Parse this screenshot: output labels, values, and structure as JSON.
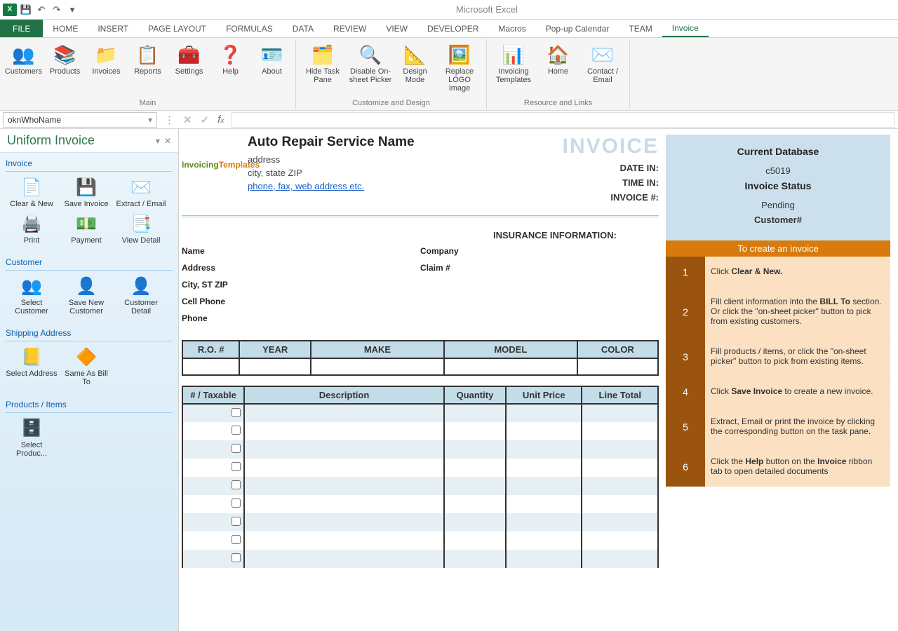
{
  "app_title": "Microsoft Excel",
  "ribbon_tabs": [
    "FILE",
    "HOME",
    "INSERT",
    "PAGE LAYOUT",
    "FORMULAS",
    "DATA",
    "REVIEW",
    "VIEW",
    "DEVELOPER",
    "Macros",
    "Pop-up Calendar",
    "TEAM",
    "Invoice"
  ],
  "ribbon_groups": {
    "main_label": "Main",
    "customize_label": "Customize and Design",
    "resource_label": "Resource and Links",
    "main": [
      "Customers",
      "Products",
      "Invoices",
      "Reports",
      "Settings",
      "Help",
      "About"
    ],
    "customize": [
      "Hide Task Pane",
      "Disable On-sheet Picker",
      "Design Mode",
      "Replace LOGO Image"
    ],
    "resource": [
      "Invoicing Templates",
      "Home",
      "Contact / Email"
    ]
  },
  "namebox": "oknWhoName",
  "taskpane": {
    "title": "Uniform Invoice",
    "sections": {
      "invoice": {
        "title": "Invoice",
        "items": [
          "Clear & New",
          "Save Invoice",
          "Extract / Email",
          "Print",
          "Payment",
          "View Detail"
        ]
      },
      "customer": {
        "title": "Customer",
        "items": [
          "Select Customer",
          "Save New Customer",
          "Customer Detail"
        ]
      },
      "shipping": {
        "title": "Shipping Address",
        "items": [
          "Select Address",
          "Same As Bill To"
        ]
      },
      "products": {
        "title": "Products / Items",
        "items": [
          "Select Produc..."
        ]
      }
    }
  },
  "invoice": {
    "logo_text_a": "Invoicing",
    "logo_text_b": "Templates",
    "business_name": "Auto Repair Service Name",
    "address_line": "address",
    "city_line": "city, state ZIP",
    "contact_line": "phone, fax, web address etc.",
    "title": "INVOICE",
    "meta": {
      "date_in": "DATE IN:",
      "time_in": "TIME IN:",
      "invoice_no": "INVOICE #:"
    },
    "insurance_title": "INSURANCE INFORMATION:",
    "bill_labels": {
      "name": "Name",
      "address": "Address",
      "city": "City, ST ZIP",
      "cell": "Cell Phone",
      "phone": "Phone",
      "company": "Company",
      "claim": "Claim #"
    },
    "veh_headers": [
      "R.O. #",
      "YEAR",
      "MAKE",
      "MODEL",
      "COLOR"
    ],
    "item_headers": [
      "# / Taxable",
      "Description",
      "Quantity",
      "Unit Price",
      "Line Total"
    ]
  },
  "help": {
    "db_title": "Current Database",
    "db_name": "c5019",
    "status_label": "Invoice Status",
    "status_value": "Pending",
    "customer_label": "Customer#",
    "create_title": "To create an invoice",
    "steps": [
      {
        "n": "1",
        "html": "Click <b>Clear & New.</b>"
      },
      {
        "n": "2",
        "html": "Fill client information into the <b>BILL To</b> section. Or click the \"on-sheet picker\" button to pick from existing customers."
      },
      {
        "n": "3",
        "html": "Fill products / items, or click the \"on-sheet picker\" button to pick from existing items."
      },
      {
        "n": "4",
        "html": "Click <b>Save Invoice</b> to create a new invoice."
      },
      {
        "n": "5",
        "html": "Extract, Email or print the invoice by clicking the corresponding button on the task pane."
      },
      {
        "n": "6",
        "html": "Click the <b>Help</b> button on the <b>Invoice</b> ribbon tab to open detailed documents"
      }
    ]
  }
}
